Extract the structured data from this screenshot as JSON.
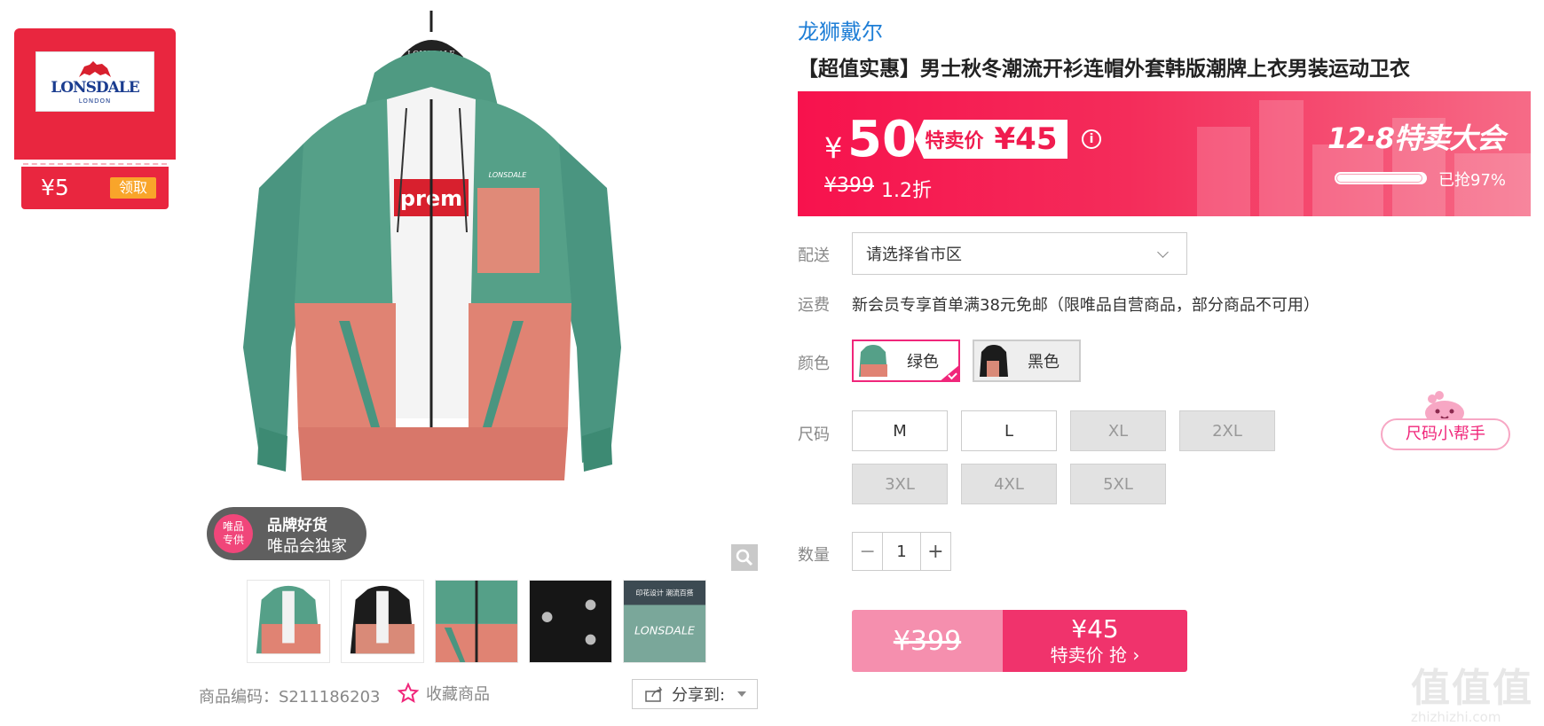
{
  "coupon": {
    "brand_logo_text": "LONSDALE",
    "brand_logo_sub": "LONDON",
    "amount": "¥5",
    "claim_label": "领取"
  },
  "gallery": {
    "badge_circle_line1": "唯品",
    "badge_circle_line2": "专供",
    "badge_line1": "品牌好货",
    "badge_line2": "唯品会独家",
    "thumbnails": [
      "green-hoodie",
      "black-hoodie",
      "detail-closeup",
      "fabric-detail",
      "print-detail"
    ],
    "thumb5_caption": "印花设计 潮流百搭",
    "thumb5_logo": "LONSDALE",
    "chest_logo": "LONSDALE",
    "hanger_logo": "LONSDALE",
    "shirt_print": "prem"
  },
  "meta": {
    "product_code": "商品编码：S211186203",
    "favorite_label": "收藏商品",
    "share_label": "分享到:"
  },
  "product": {
    "brand": "龙狮戴尔",
    "title": "【超值实惠】男士秋冬潮流开衫连帽外套韩版潮牌上衣男装运动卫衣"
  },
  "price": {
    "currency": "¥",
    "current": "50",
    "tag_label": "特卖价",
    "tag_price": "¥45",
    "info_icon": "i",
    "original": "¥399",
    "discount": "1.2折",
    "event": "12·8特卖大会",
    "sold_fraction": 0.97,
    "sold_label": "已抢97%"
  },
  "delivery": {
    "label": "配送",
    "placeholder": "请选择省市区"
  },
  "shipping": {
    "label": "运费",
    "text": "新会员专享首单满38元免邮（限唯品自营商品，部分商品不可用）"
  },
  "colors": {
    "label": "颜色",
    "options": [
      {
        "name": "绿色",
        "selected": true
      },
      {
        "name": "黑色",
        "selected": false
      }
    ]
  },
  "sizes": {
    "label": "尺码",
    "options": [
      {
        "name": "M",
        "available": true
      },
      {
        "name": "L",
        "available": true
      },
      {
        "name": "XL",
        "available": false
      },
      {
        "name": "2XL",
        "available": false
      },
      {
        "name": "3XL",
        "available": false
      },
      {
        "name": "4XL",
        "available": false
      },
      {
        "name": "5XL",
        "available": false
      }
    ],
    "helper_label": "尺码小帮手"
  },
  "quantity": {
    "label": "数量",
    "minus": "−",
    "value": "1",
    "plus": "+"
  },
  "buy": {
    "original": "¥399",
    "price": "¥45",
    "action": "特卖价 抢 ›"
  },
  "watermark": {
    "big": "值值值",
    "small": "zhizhizhi.com"
  },
  "colors_theme": {
    "accent": "#f0267a",
    "banner": "#f7124d",
    "link": "#1e7ed6",
    "coupon": "#e9263f"
  }
}
